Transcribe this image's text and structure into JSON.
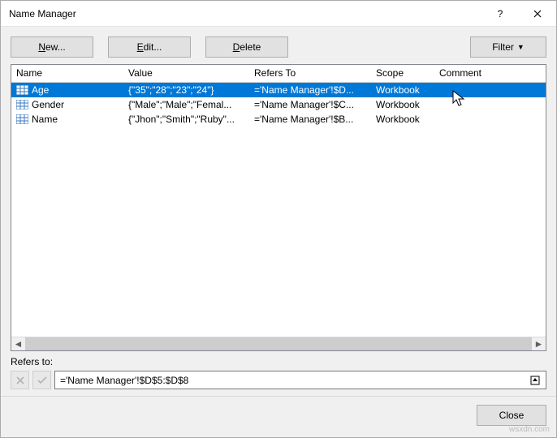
{
  "window": {
    "title": "Name Manager"
  },
  "toolbar": {
    "new_label": "New...",
    "edit_label": "Edit...",
    "delete_label": "Delete",
    "filter_label": "Filter"
  },
  "columns": {
    "name": "Name",
    "value": "Value",
    "refers_to": "Refers To",
    "scope": "Scope",
    "comment": "Comment"
  },
  "rows": [
    {
      "name": "Age",
      "value": "{\"35\";\"28\";\"23\";\"24\"}",
      "refers_to": "='Name Manager'!$D...",
      "scope": "Workbook",
      "comment": "",
      "selected": true
    },
    {
      "name": "Gender",
      "value": "{\"Male\";\"Male\";\"Femal...",
      "refers_to": "='Name Manager'!$C...",
      "scope": "Workbook",
      "comment": "",
      "selected": false
    },
    {
      "name": "Name",
      "value": "{\"Jhon\";\"Smith\";\"Ruby\"...",
      "refers_to": "='Name Manager'!$B...",
      "scope": "Workbook",
      "comment": "",
      "selected": false
    }
  ],
  "refers": {
    "label": "Refers to:",
    "value": "='Name Manager'!$D$5:$D$8"
  },
  "footer": {
    "close_label": "Close"
  },
  "watermark": "wsxdn.com"
}
